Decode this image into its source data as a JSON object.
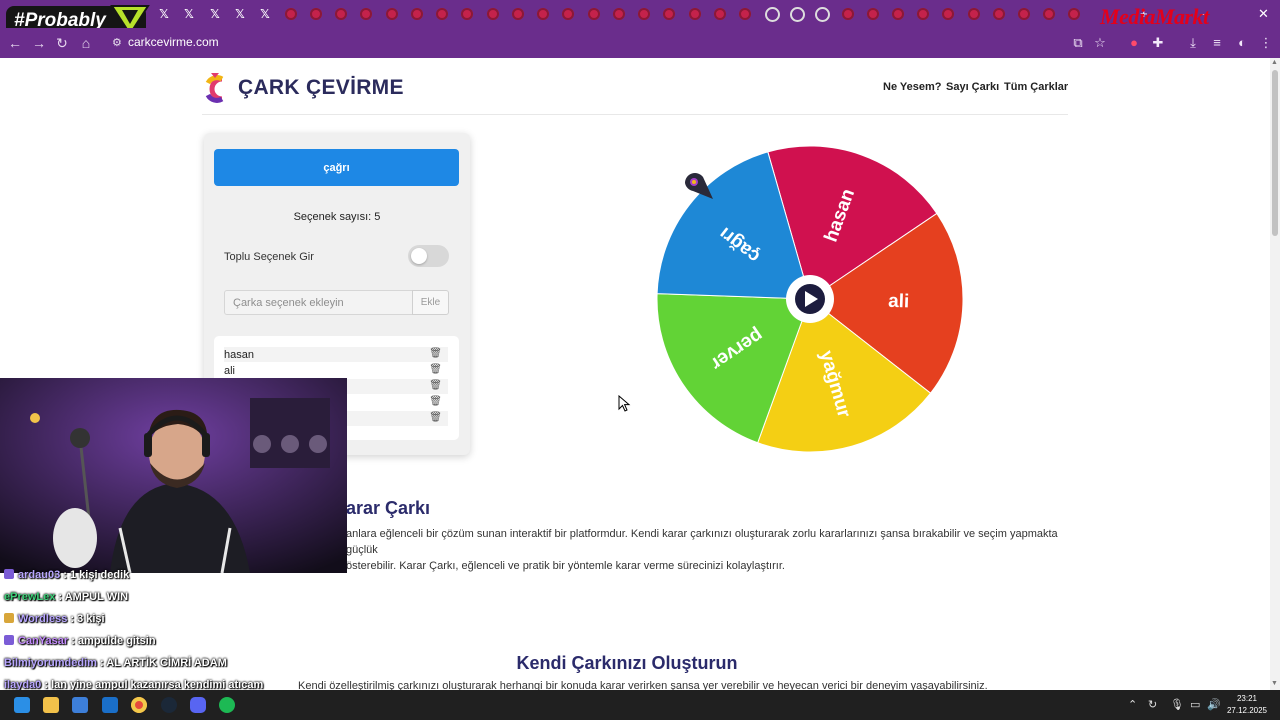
{
  "browser": {
    "url": "carkcevirme.com",
    "overlay_logo": "#Probably",
    "sponsor_logo": "MediaMarkt",
    "tab_icons": [
      "probably-icon",
      "x-icon",
      "x-icon",
      "x-icon",
      "x-icon",
      "red-icon",
      "globe-icon"
    ]
  },
  "site": {
    "title": "ÇARK ÇEVİRME",
    "nav": [
      "Ne Yesem?",
      "Sayı Çarkı",
      "Tüm Çarklar"
    ]
  },
  "panel": {
    "spin_label": "çağrı",
    "count_label": "Seçenek sayısı: 5",
    "bulk_label": "Toplu Seçenek Gir",
    "bulk_enabled": false,
    "input_placeholder": "Çarka seçenek ekleyin",
    "add_label": "Ekle",
    "options": [
      "hasan",
      "ali",
      "",
      "",
      ""
    ]
  },
  "wheel": {
    "segments": [
      {
        "label": "hasan",
        "color": "#d0114f"
      },
      {
        "label": "ali",
        "color": "#e5401f"
      },
      {
        "label": "yağmur",
        "color": "#f4cf14"
      },
      {
        "label": "perver",
        "color": "#62d336"
      },
      {
        "label": "çağrı",
        "color": "#1e88d6"
      }
    ]
  },
  "content": {
    "heading1": "arar Çarkı",
    "para1_line1": "anlara eğlenceli bir çözüm sunan interaktif bir platformdur. Kendi karar çarkınızı oluşturarak zorlu kararlarınızı şansa bırakabilir ve seçim yapmakta güçlük",
    "para1_line2": "österebilir. Karar Çarkı, eğlenceli ve pratik bir yöntemle karar verme sürecinizi kolaylaştırır.",
    "heading2": "Kendi Çarkınızı Oluşturun",
    "para2": "Kendi özelleştirilmiş çarkınızı oluşturarak herhangi bir konuda karar verirken şansa yer verebilir ve heyecan verici bir deneyim yaşayabilirsiniz."
  },
  "chat": [
    {
      "user": "ardau03",
      "text": " : 1 kişi dedik",
      "color": "#b8a6ff",
      "badge": "#7b5cd6"
    },
    {
      "user": "ePrewLex",
      "text": " : AMPUL WIN",
      "color": "#3fd07a",
      "badge": ""
    },
    {
      "user": "Wordless",
      "text": " : 3 kişi",
      "color": "#b8a6ff",
      "badge": "#d8a63a"
    },
    {
      "user": "CanYasar",
      "text": " : ampulde gitsin",
      "color": "#c58cff",
      "badge": "#7b5cd6"
    },
    {
      "user": "Bilmiyorumdedim",
      "text": " : AL ARTİK CİMRİ ADAM",
      "color": "#b8a6ff",
      "badge": ""
    },
    {
      "user": "ilayda0",
      "text": " : lan yine ampul kazanırsa kendimi atıcam",
      "color": "#b8a6ff",
      "badge": ""
    }
  ],
  "taskbar": {
    "time": "23:21",
    "date": "27.12.2025",
    "apps": [
      "windows-icon",
      "files-icon",
      "store-icon",
      "outlook-icon",
      "chrome-icon",
      "steam-icon",
      "discord-icon",
      "spotify-icon"
    ]
  }
}
